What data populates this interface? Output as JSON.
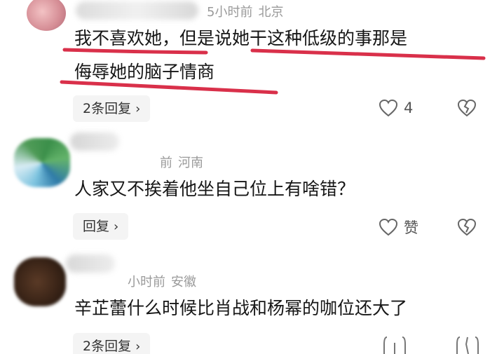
{
  "comments": [
    {
      "meta": {
        "time": "5小时前",
        "location": "北京"
      },
      "text_lines": [
        "我不喜欢她，但是说她干这种低级的事那是",
        "侮辱她的脑子情商"
      ],
      "reply_label": "2条回复",
      "like_count": "4",
      "icons": {
        "like": "heart-outline-icon",
        "dislike": "broken-heart-icon",
        "reply_arrow": "chevron-right-icon"
      }
    },
    {
      "meta": {
        "time": "前",
        "location": "河南"
      },
      "text_lines": [
        "人家又不挨着他坐自己位上有啥错？"
      ],
      "reply_label": "回复",
      "like_count": "赞",
      "icons": {
        "like": "heart-outline-icon",
        "dislike": "broken-heart-icon",
        "reply_arrow": "chevron-right-icon"
      }
    },
    {
      "meta": {
        "time": "小时前",
        "location": "安徽"
      },
      "text_lines": [
        "辛芷蕾什么时候比肖战和杨幂的咖位还大了"
      ],
      "reply_label": "2条回复",
      "like_count": "",
      "icons": {
        "like": "heart-outline-icon",
        "dislike": "broken-heart-icon",
        "reply_arrow": "chevron-right-icon"
      }
    }
  ],
  "colors": {
    "underline": "#d9304a",
    "meta": "#9a9a9a",
    "text": "#161616",
    "button_bg": "#f4f4f4"
  }
}
